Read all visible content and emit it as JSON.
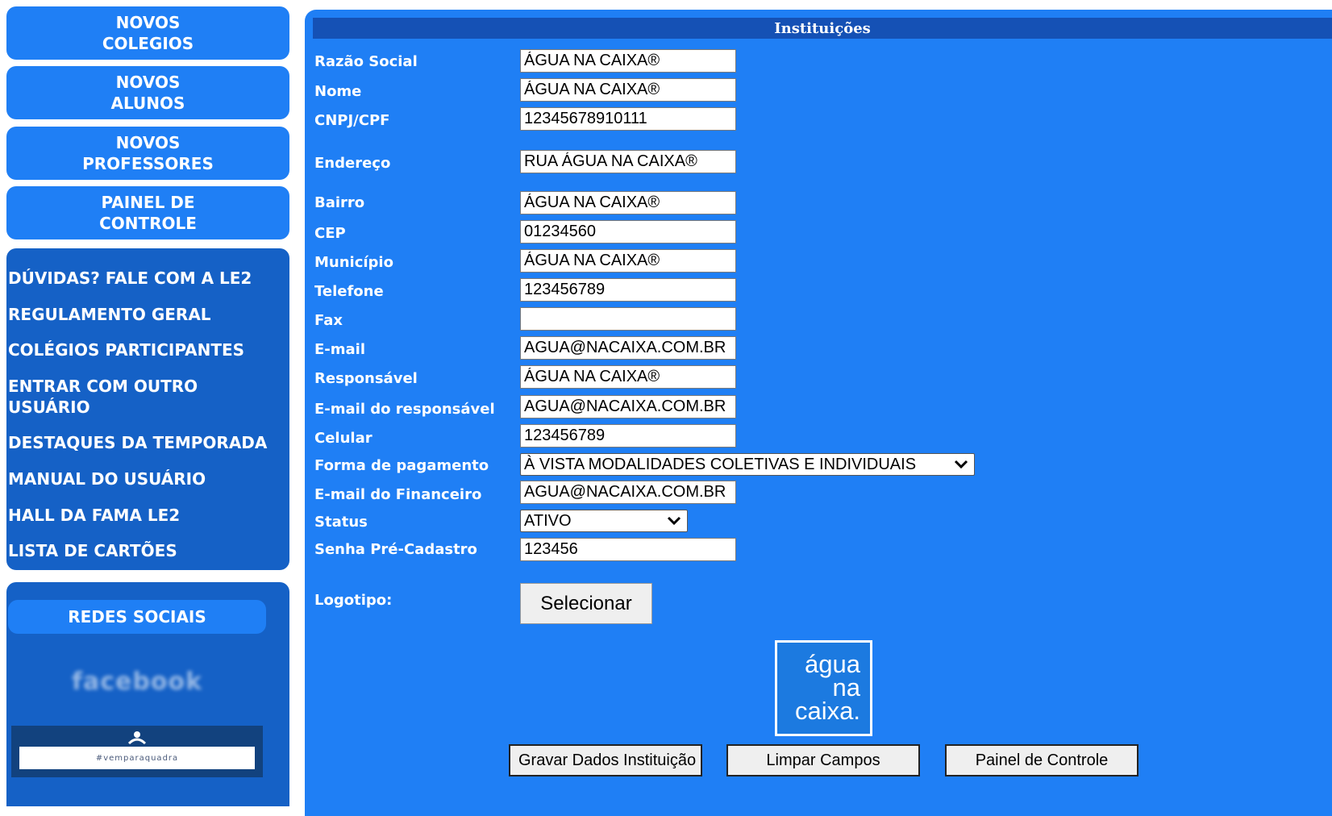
{
  "sidebar": {
    "buttons": [
      {
        "line1": "NOVOS",
        "line2": "COLEGIOS"
      },
      {
        "line1": "NOVOS",
        "line2": "ALUNOS"
      },
      {
        "line1": "NOVOS",
        "line2": "PROFESSORES"
      },
      {
        "line1": "PAINEL DE",
        "line2": "CONTROLE"
      }
    ],
    "menu": [
      "DÚVIDAS? FALE COM A LE2",
      "REGULAMENTO GERAL",
      "COLÉGIOS PARTICIPANTES",
      "ENTRAR COM OUTRO",
      "USUÁRIO",
      "DESTAQUES DA TEMPORADA",
      "MANUAL DO USUÁRIO",
      "HALL DA FAMA LE2",
      "LISTA DE CARTÕES"
    ],
    "social": {
      "title": "REDES SOCIAIS",
      "facebook": "facebook",
      "banner_text": "#vemparaquadra"
    }
  },
  "form": {
    "title": "Instituições",
    "fields": [
      {
        "label": "Razão Social",
        "value": "ÁGUA NA CAIXA®"
      },
      {
        "label": "Nome",
        "value": "ÁGUA NA CAIXA®"
      },
      {
        "label": "CNPJ/CPF",
        "value": "12345678910111"
      },
      {
        "label": "Endereço",
        "value": "RUA ÁGUA NA CAIXA®"
      },
      {
        "label": "Bairro",
        "value": "ÁGUA NA CAIXA®"
      },
      {
        "label": "CEP",
        "value": "01234560"
      },
      {
        "label": "Município",
        "value": "ÁGUA NA CAIXA®"
      },
      {
        "label": "Telefone",
        "value": "123456789"
      },
      {
        "label": "Fax",
        "value": ""
      },
      {
        "label": "E-mail",
        "value": "AGUA@NACAIXA.COM.BR"
      },
      {
        "label": "Responsável",
        "value": "ÁGUA NA CAIXA®"
      },
      {
        "label": "E-mail do responsável",
        "value": "AGUA@NACAIXA.COM.BR"
      },
      {
        "label": "Celular",
        "value": "123456789"
      },
      {
        "label": "E-mail do Financeiro",
        "value": "AGUA@NACAIXA.COM.BR"
      },
      {
        "label": "Senha Pré-Cadastro",
        "value": "123456"
      }
    ],
    "payment": {
      "label": "Forma de pagamento",
      "selected": "À VISTA MODALIDADES COLETIVAS E INDIVIDUAIS"
    },
    "status": {
      "label": "Status",
      "selected": "ATIVO"
    },
    "logo": {
      "label": "Logotipo:",
      "select_button": "Selecionar",
      "image_lines": [
        "água",
        "na",
        "caixa."
      ]
    },
    "actions": {
      "save": "Gravar Dados Instituição",
      "clear": "Limpar Campos",
      "panel": "Painel de Controle"
    }
  },
  "colors": {
    "panel_bg": "#1f7ff5",
    "sidebar_dark": "#1561c6",
    "title_bar": "#1551b5"
  }
}
